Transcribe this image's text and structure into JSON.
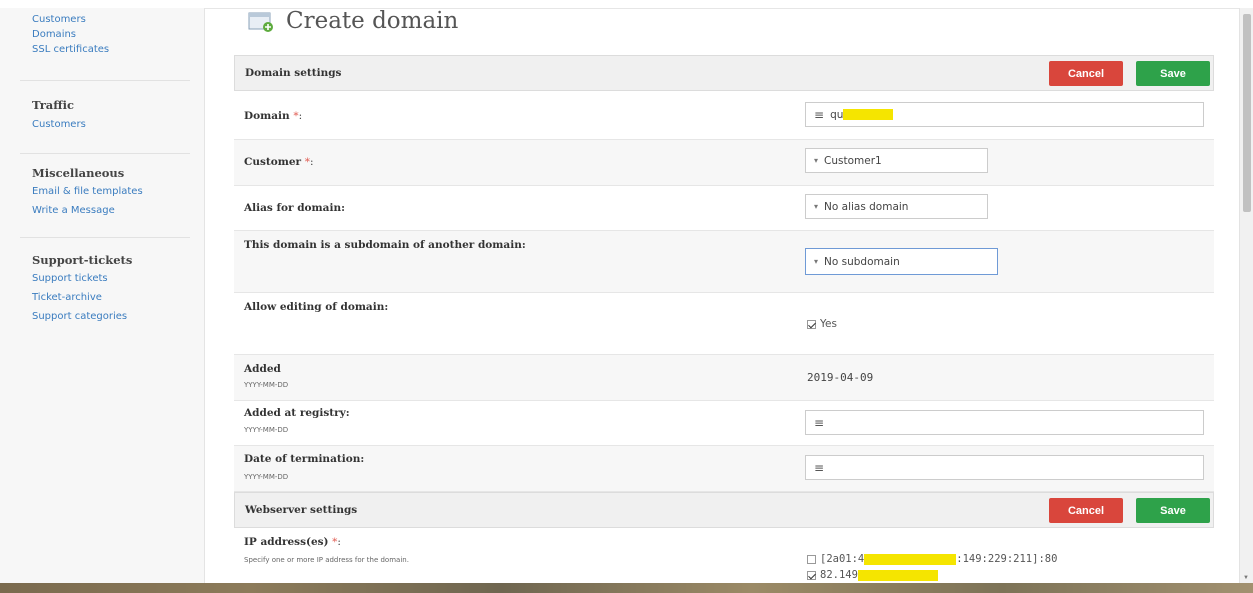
{
  "sidebar": {
    "top_links": [
      "Customers",
      "Domains",
      "SSL certificates"
    ],
    "traffic": {
      "heading": "Traffic",
      "links": [
        "Customers"
      ]
    },
    "misc": {
      "heading": "Miscellaneous",
      "links": [
        "Email & file templates",
        "Write a Message"
      ]
    },
    "support": {
      "heading": "Support-tickets",
      "links": [
        "Support tickets",
        "Ticket-archive",
        "Support categories"
      ]
    }
  },
  "page": {
    "title": "Create domain"
  },
  "domain_settings": {
    "heading": "Domain settings",
    "cancel_label": "Cancel",
    "save_label": "Save",
    "domain": {
      "label": "Domain",
      "required": "*",
      "suffix": ":",
      "value": "qu"
    },
    "customer": {
      "label": "Customer",
      "required": "*",
      "suffix": ":",
      "value": "Customer1"
    },
    "alias": {
      "label": "Alias for domain:",
      "value": "No alias domain"
    },
    "subdomain": {
      "label": "This domain is a subdomain of another domain:",
      "value": "No subdomain"
    },
    "allow_edit": {
      "label": "Allow editing of domain:",
      "option": "Yes",
      "checked": true
    },
    "added": {
      "label": "Added",
      "hint": "YYYY-MM-DD",
      "value": "2019-04-09"
    },
    "added_registry": {
      "label": "Added at registry:",
      "hint": "YYYY-MM-DD",
      "value": ""
    },
    "termination": {
      "label": "Date of termination:",
      "hint": "YYYY-MM-DD",
      "value": ""
    }
  },
  "webserver_settings": {
    "heading": "Webserver settings",
    "cancel_label": "Cancel",
    "save_label": "Save",
    "ip": {
      "label": "IP address(es)",
      "required": "*",
      "suffix": ":",
      "hint": "Specify one or more IP address for the domain.",
      "options": [
        {
          "prefix": "[2a01:4",
          "suffix": ":149:229:211]:80",
          "checked": false
        },
        {
          "prefix": "82.149",
          "suffix": "",
          "checked": true
        }
      ]
    }
  },
  "icons": {
    "title": "domain-create-icon",
    "input": "list-lines-icon",
    "select": "caret-down-icon"
  },
  "colors": {
    "link": "#3a7cbf",
    "cancel": "#d9463c",
    "save": "#2ea24a",
    "redaction": "#f5e500",
    "required": "#e05a50"
  }
}
